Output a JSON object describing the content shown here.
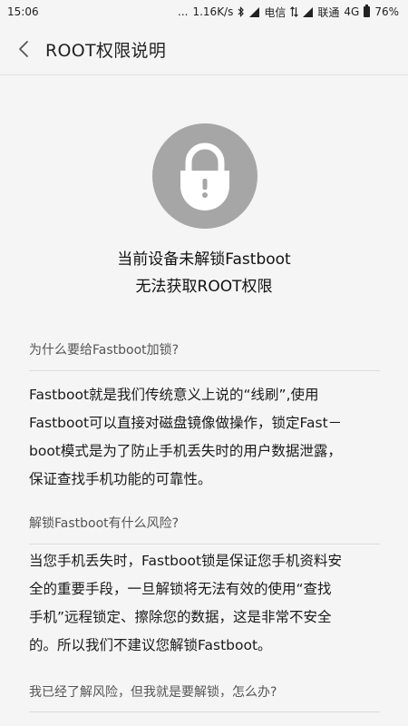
{
  "status_bar": {
    "time": "15:06",
    "dots": "...",
    "speed": "1.16K/s",
    "carrier1": "电信",
    "carrier2": "联通",
    "network": "4G",
    "battery": "76%"
  },
  "nav": {
    "title": "ROOT权限说明"
  },
  "hero": {
    "line1": "当前设备未解锁Fastboot",
    "line2": "无法获取ROOT权限"
  },
  "sections": [
    {
      "question": "为什么要给Fastboot加锁?",
      "answer": "Fastboot就是我们传统意义上说的“线刷”,使用\nFastboot可以直接对磁盘镜像做操作，锁定Fast－\nboot模式是为了防止手机丢失时的用户数据泄露，\n保证查找手机功能的可靠性。"
    },
    {
      "question": "解锁Fastboot有什么风险?",
      "answer": "当您手机丢失时，Fastboot锁是保证您手机资料安\n全的重要手段，一旦解锁将无法有效的使用“查找\n手机”远程锁定、擦除您的数据，这是非常不安全\n的。所以我们不建议您解锁Fastboot。"
    },
    {
      "question": "我已经了解风险，但我就是要解锁，怎么办?"
    }
  ],
  "colors": {
    "background": "#f5f5f5",
    "lock_circle": "#a6a6a6",
    "divider": "#dcdcdc"
  }
}
